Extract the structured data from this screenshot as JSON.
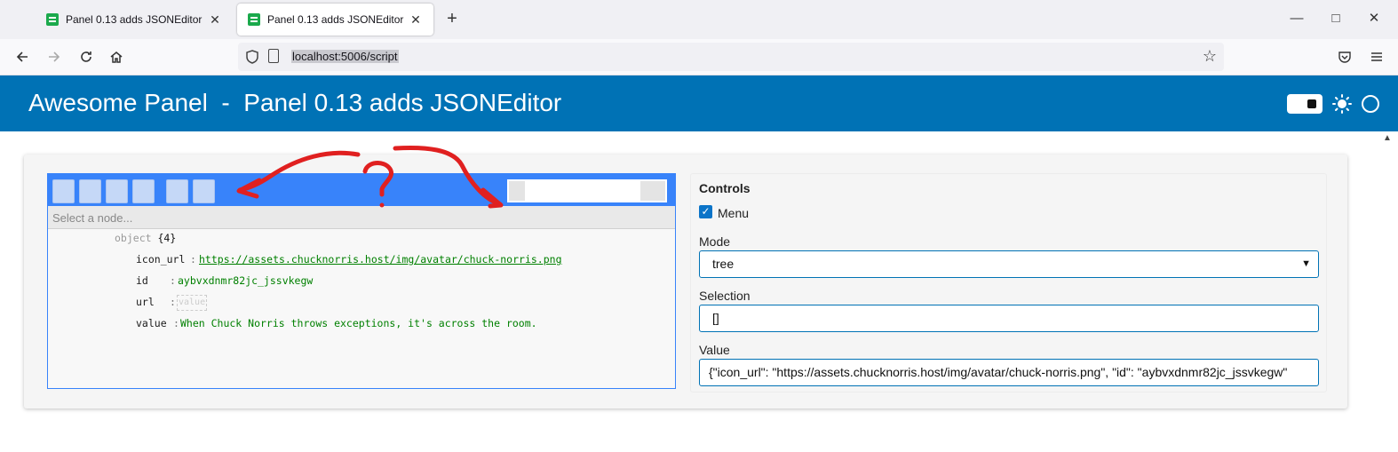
{
  "browser": {
    "tabs": [
      {
        "title": "Panel 0.13 adds JSONEditor",
        "active": false
      },
      {
        "title": "Panel 0.13 adds JSONEditor",
        "active": true
      }
    ],
    "new_tab_icon": "plus-icon",
    "url": "localhost:5006/script",
    "window_controls": [
      "minimize-icon",
      "maximize-icon",
      "close-icon"
    ]
  },
  "header": {
    "title": "Awesome Panel  -  Panel 0.13 adds JSONEditor",
    "background": "#0072b5"
  },
  "json_editor": {
    "accent": "#3883fa",
    "navbar_placeholder": "Select a node...",
    "root": {
      "type": "object",
      "count": "{4}"
    },
    "fields": [
      {
        "key": "icon_url",
        "value": "https://assets.chucknorris.host/img/avatar/chuck-norris.png"
      },
      {
        "key": "id",
        "value": "aybvxdnmr82jc_jssvkegw"
      },
      {
        "key": "url",
        "value": "value"
      },
      {
        "key": "value",
        "value": "When Chuck Norris throws exceptions, it's across the room."
      }
    ]
  },
  "controls": {
    "title": "Controls",
    "menu_label": "Menu",
    "menu_checked": true,
    "mode_label": "Mode",
    "mode_value": "tree",
    "selection_label": "Selection",
    "selection_value": "[]",
    "value_label": "Value",
    "value_text": "{\"icon_url\": \"https://assets.chucknorris.host/img/avatar/chuck-norris.png\", \"id\": \"aybvxdnmr82jc_jssvkegw\""
  },
  "annotation_color": "#e02020"
}
